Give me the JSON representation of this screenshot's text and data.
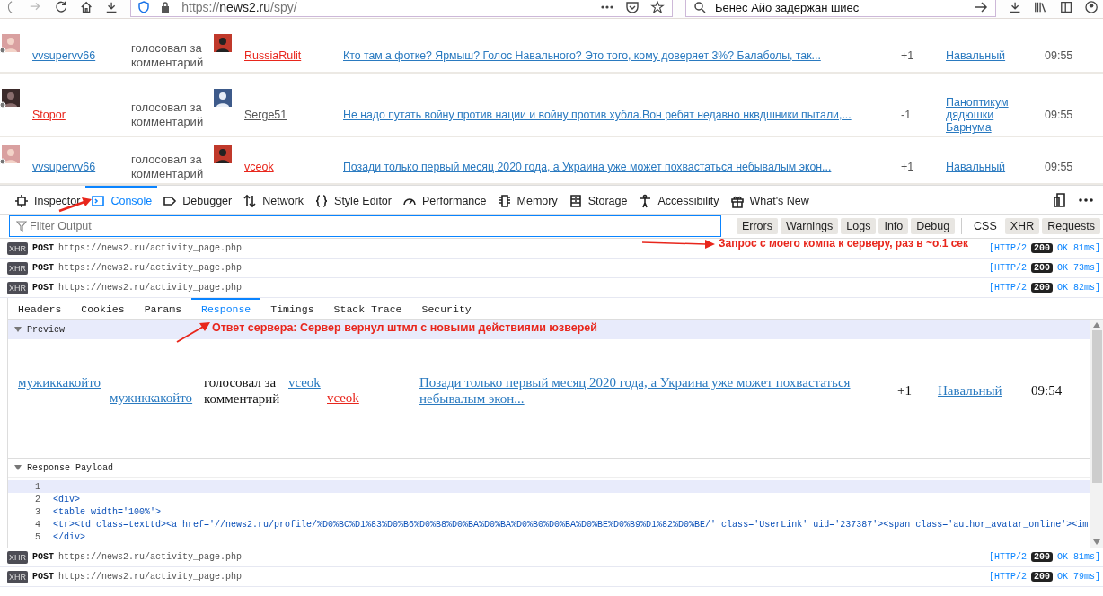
{
  "browser": {
    "url": {
      "scheme": "https://",
      "host": "news2.ru",
      "path": "/spy/"
    },
    "search": "Бенес Айо задержан шиес"
  },
  "activity_rows": [
    {
      "actor": {
        "name": "vvsupervv66",
        "color": "#2a7ac0"
      },
      "action": "голосовал за комментарий",
      "target": {
        "name": "RussiaRulit",
        "color": "#e8261c"
      },
      "comment": "Кто там а фотке? Ярмыш? Голос Навального? Это того, кому доверяет 3%? Балаболы, так...",
      "vote": "+1",
      "topic": "Навальный",
      "time": "09:55"
    },
    {
      "actor": {
        "name": "Stopor",
        "color": "#e8261c"
      },
      "action": "голосовал за комментарий",
      "target": {
        "name": "Serge51",
        "color": "#555555"
      },
      "comment": "Не надо путать войну против нации и войну против хубла.Вон ребят недавно нквдшники пытали,...",
      "vote": "-1",
      "topic": "Паноптикум дядюшки Барнума",
      "time": "09:55"
    },
    {
      "actor": {
        "name": "vvsupervv66",
        "color": "#2a7ac0"
      },
      "action": "голосовал за комментарий",
      "target": {
        "name": "vceok",
        "color": "#e8261c"
      },
      "comment": "Позади только первый месяц 2020 года, а Украина уже может похвастаться небывалым экон...",
      "vote": "+1",
      "topic": "Навальный",
      "time": "09:55"
    }
  ],
  "devtools": {
    "tabs": [
      {
        "label": "Inspector",
        "selected": false
      },
      {
        "label": "Console",
        "selected": true
      },
      {
        "label": "Debugger",
        "selected": false
      },
      {
        "label": "Network",
        "selected": false
      },
      {
        "label": "Style Editor",
        "selected": false
      },
      {
        "label": "Performance",
        "selected": false
      },
      {
        "label": "Memory",
        "selected": false
      },
      {
        "label": "Storage",
        "selected": false
      },
      {
        "label": "Accessibility",
        "selected": false
      },
      {
        "label": "What's New",
        "selected": false
      }
    ],
    "filter": {
      "placeholder": "Filter Output"
    },
    "log_filters": [
      {
        "label": "Errors",
        "selected": true
      },
      {
        "label": "Warnings",
        "selected": true
      },
      {
        "label": "Logs",
        "selected": true
      },
      {
        "label": "Info",
        "selected": true
      },
      {
        "label": "Debug",
        "selected": true
      }
    ],
    "net_filters": [
      {
        "label": "CSS",
        "selected": false
      },
      {
        "label": "XHR",
        "selected": true
      },
      {
        "label": "Requests",
        "selected": true
      }
    ],
    "requests_before": [
      {
        "badge": "XHR",
        "method": "POST",
        "url": "https://news2.ru/activity_page.php",
        "protocol": "[HTTP/2",
        "status": "200",
        "result": "OK 81ms]"
      },
      {
        "badge": "XHR",
        "method": "POST",
        "url": "https://news2.ru/activity_page.php",
        "protocol": "[HTTP/2",
        "status": "200",
        "result": "OK 73ms]"
      },
      {
        "badge": "XHR",
        "method": "POST",
        "url": "https://news2.ru/activity_page.php",
        "protocol": "[HTTP/2",
        "status": "200",
        "result": "OK 82ms]"
      }
    ],
    "detail_tabs": [
      {
        "label": "Headers",
        "selected": false
      },
      {
        "label": "Cookies",
        "selected": false
      },
      {
        "label": "Params",
        "selected": false
      },
      {
        "label": "Response",
        "selected": true
      },
      {
        "label": "Timings",
        "selected": false
      },
      {
        "label": "Stack Trace",
        "selected": false
      },
      {
        "label": "Security",
        "selected": false
      }
    ],
    "preview": {
      "title": "Preview",
      "expanded": true,
      "actor_avatar_alt": "мужиккакойто",
      "actor": {
        "name": "мужиккакойто",
        "color": "#2a7ac0"
      },
      "action": "голосовал за комментарий",
      "target_avatar_alt": "vceok",
      "target": {
        "name": "vceok",
        "color": "#e8261c"
      },
      "comment": "Позади только первый месяц 2020 года, а Украина уже может похвастаться небывалым экон...",
      "vote": "+1",
      "topic": "Навальный",
      "time": "09:54"
    },
    "payload": {
      "title": "Response Payload",
      "expanded": true,
      "lines": [
        {
          "number": "1"
        },
        {
          "number": "2",
          "code": "<div>"
        },
        {
          "number": "3",
          "code": "<table width='100%'>"
        },
        {
          "number": "4",
          "code": "<tr><td class=texttd><a href='//news2.ru/profile/%D0%BC%D1%83%D0%B6%D0%B8%D0%BA%D0%BA%D0%B0%D0%BA%D0%BE%D0%B9%D1%82%D0%BE/' class='UserLink' uid='237387'><span class='author_avatar_online'><im"
        },
        {
          "number": "5",
          "code": "</div>"
        }
      ]
    },
    "requests_after": [
      {
        "badge": "XHR",
        "method": "POST",
        "url": "https://news2.ru/activity_page.php",
        "protocol": "[HTTP/2",
        "status": "200",
        "result": "OK 81ms]"
      },
      {
        "badge": "XHR",
        "method": "POST",
        "url": "https://news2.ru/activity_page.php",
        "protocol": "[HTTP/2",
        "status": "200",
        "result": "OK 79ms]"
      }
    ]
  },
  "annotations": [
    {
      "text": "Запрос с моего компа к серверу, раз в ~o.1 сек"
    },
    {
      "text": "Ответ сервера: Сервер вернул штмл с новыми действиями юзверей"
    }
  ]
}
